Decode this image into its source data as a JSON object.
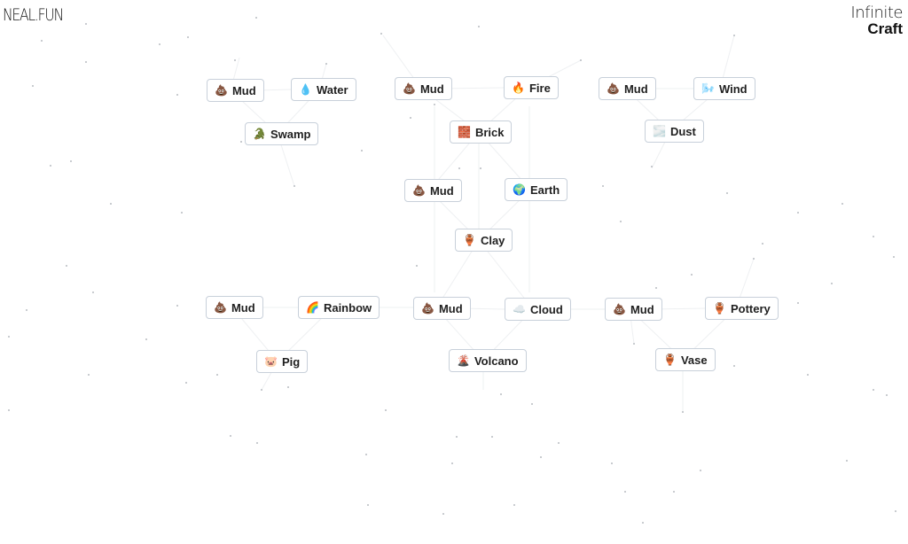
{
  "header": {
    "brand": "NEAL.FUN",
    "app_title_line1": "Infinite",
    "app_title_line2": "Craft"
  },
  "nodes": [
    {
      "id": "n1",
      "label": "Mud",
      "icon": "pile-of-poo-icon",
      "emoji": "💩"
    },
    {
      "id": "n2",
      "label": "Water",
      "icon": "droplet-icon",
      "emoji": "💧"
    },
    {
      "id": "n3",
      "label": "Swamp",
      "icon": "crocodile-icon",
      "emoji": "🐊"
    },
    {
      "id": "n4",
      "label": "Mud",
      "icon": "pile-of-poo-icon",
      "emoji": "💩"
    },
    {
      "id": "n5",
      "label": "Fire",
      "icon": "fire-icon",
      "emoji": "🔥"
    },
    {
      "id": "n6",
      "label": "Brick",
      "icon": "brick-icon",
      "emoji": "🧱"
    },
    {
      "id": "n7",
      "label": "Mud",
      "icon": "pile-of-poo-icon",
      "emoji": "💩"
    },
    {
      "id": "n8",
      "label": "Wind",
      "icon": "wind-icon",
      "emoji": "🌬️"
    },
    {
      "id": "n9",
      "label": "Dust",
      "icon": "dust-icon",
      "emoji": "🌫️"
    },
    {
      "id": "n10",
      "label": "Mud",
      "icon": "pile-of-poo-icon",
      "emoji": "💩"
    },
    {
      "id": "n11",
      "label": "Earth",
      "icon": "globe-icon",
      "emoji": "🌍"
    },
    {
      "id": "n12",
      "label": "Clay",
      "icon": "amphora-icon",
      "emoji": "🏺"
    },
    {
      "id": "n13",
      "label": "Mud",
      "icon": "pile-of-poo-icon",
      "emoji": "💩"
    },
    {
      "id": "n14",
      "label": "Rainbow",
      "icon": "rainbow-icon",
      "emoji": "🌈"
    },
    {
      "id": "n15",
      "label": "Pig",
      "icon": "pig-face-icon",
      "emoji": "🐷"
    },
    {
      "id": "n16",
      "label": "Mud",
      "icon": "pile-of-poo-icon",
      "emoji": "💩"
    },
    {
      "id": "n17",
      "label": "Cloud",
      "icon": "cloud-icon",
      "emoji": "☁️"
    },
    {
      "id": "n18",
      "label": "Volcano",
      "icon": "volcano-icon",
      "emoji": "🌋"
    },
    {
      "id": "n19",
      "label": "Mud",
      "icon": "pile-of-poo-icon",
      "emoji": "💩"
    },
    {
      "id": "n20",
      "label": "Pottery",
      "icon": "amphora-icon",
      "emoji": "🏺"
    },
    {
      "id": "n21",
      "label": "Vase",
      "icon": "amphora-icon",
      "emoji": "🏺"
    }
  ]
}
